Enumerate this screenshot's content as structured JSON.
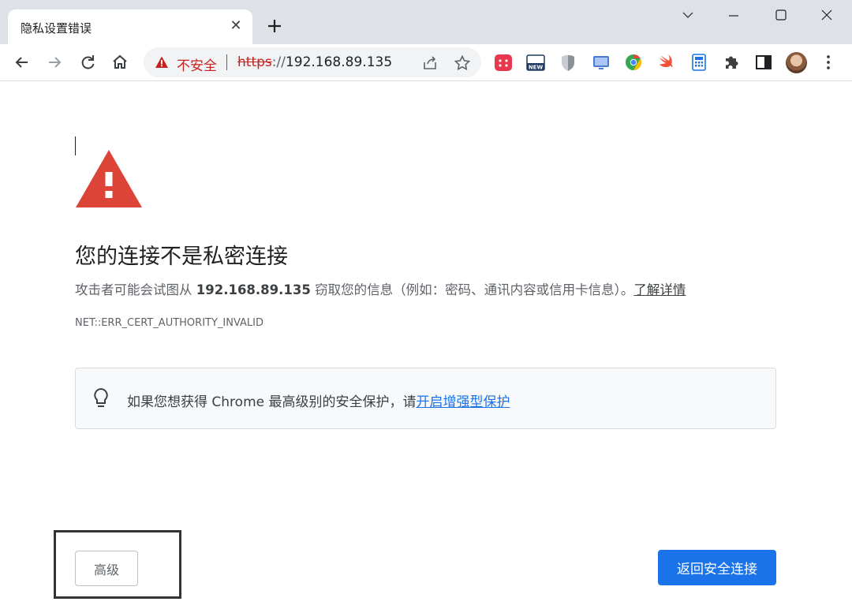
{
  "window": {
    "tab_title": "隐私设置错误",
    "tab_close_glyph": "✕"
  },
  "toolbar": {
    "security_label": "不安全",
    "url_scheme": "https",
    "url_separator": "://",
    "url_host": "192.168.89.135"
  },
  "extensions": [
    {
      "name": "calendar-extension-icon",
      "color": "#e8384f"
    },
    {
      "name": "new-badge-extension-icon",
      "color": "#1f3a5f"
    },
    {
      "name": "shield-extension-icon",
      "color": "#9aa0a6"
    },
    {
      "name": "monitor-extension-icon",
      "color": "#4a7bd1"
    },
    {
      "name": "chrome-extension-icon",
      "color": "#34a853"
    },
    {
      "name": "swift-extension-icon",
      "color": "#f05138"
    },
    {
      "name": "calculator-extension-icon",
      "color": "#1a73e8"
    }
  ],
  "page": {
    "heading": "您的连接不是私密连接",
    "desc_prefix": "攻击者可能会试图从 ",
    "desc_host": "192.168.89.135",
    "desc_suffix": " 窃取您的信息（例如：密码、通讯内容或信用卡信息）。",
    "learn_more": "了解详情",
    "error_code": "NET::ERR_CERT_AUTHORITY_INVALID",
    "promo_text": "如果您想获得 Chrome 最高级别的安全保护，请",
    "promo_link": "开启增强型保护",
    "advanced_button": "高级",
    "back_button": "返回安全连接"
  },
  "colors": {
    "warning_red": "#db4437",
    "primary_blue": "#1a73e8"
  }
}
